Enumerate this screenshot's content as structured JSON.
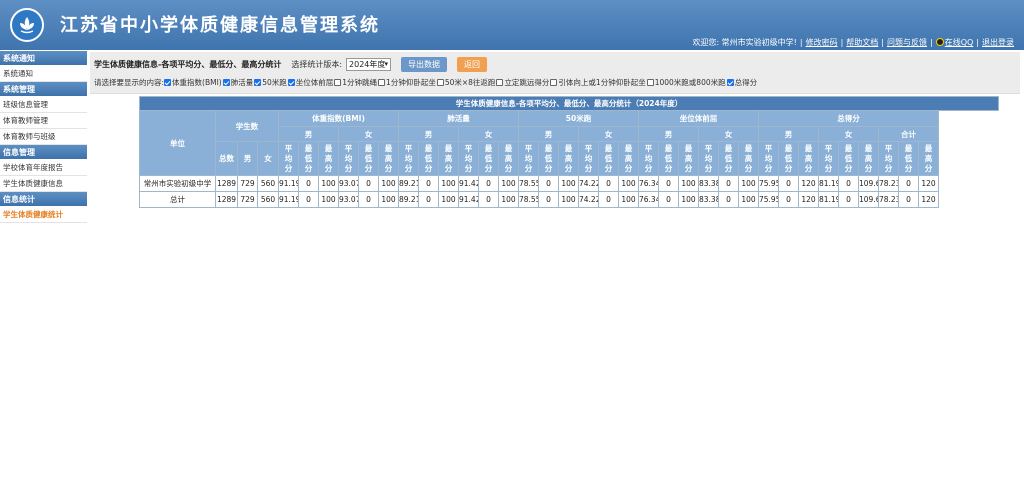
{
  "header": {
    "title": "江苏省中小学体质健康信息管理系统",
    "welcome": "欢迎您: 常州市实验初级中学!",
    "links": [
      "修改密码",
      "帮助文档",
      "问题与反馈",
      "在线QQ",
      "退出登录"
    ]
  },
  "sidebar": {
    "sections": [
      {
        "title": "系统通知",
        "items": [
          "系统通知"
        ]
      },
      {
        "title": "系统管理",
        "items": [
          "班级信息管理",
          "体育教师管理",
          "体育教师与班级"
        ]
      },
      {
        "title": "信息管理",
        "items": [
          "学校体育年度报告",
          "学生体质健康信息"
        ]
      },
      {
        "title": "信息统计",
        "items": [
          "学生体质健康统计"
        ]
      }
    ],
    "active_item": "学生体质健康统计"
  },
  "toolbar": {
    "title": "学生体质健康信息-各项平均分、最低分、最高分统计",
    "version_label": "选择统计版本:",
    "version_value": "2024年度",
    "export_label": "导出数据",
    "back_label": "返回",
    "options_label": "请选择要显示的内容:",
    "options": [
      {
        "label": "体重指数(BMI)",
        "checked": true
      },
      {
        "label": "肺活量",
        "checked": true
      },
      {
        "label": "50米跑",
        "checked": true
      },
      {
        "label": "坐位体前屈",
        "checked": true
      },
      {
        "label": "1分钟跳绳",
        "checked": false
      },
      {
        "label": "1分钟仰卧起坐",
        "checked": false
      },
      {
        "label": "50米×8往返跑",
        "checked": false
      },
      {
        "label": "立定跳远得分",
        "checked": false
      },
      {
        "label": "引体向上或1分钟仰卧起坐",
        "checked": false
      },
      {
        "label": "1000米跑或800米跑",
        "checked": false
      },
      {
        "label": "总得分",
        "checked": true
      }
    ]
  },
  "table": {
    "caption": "学生体质健康信息-各项平均分、最低分、最高分统计（2024年度）",
    "unit_header": "单位",
    "count_header": "学生数",
    "count_sub": [
      "总数",
      "男",
      "女"
    ],
    "groups": [
      "体重指数(BMI)",
      "肺活量",
      "50米跑",
      "坐位体前屈",
      "总得分"
    ],
    "sub_headers": [
      "男",
      "女"
    ],
    "total_sub_header": "合计",
    "stat_headers": [
      "平均分",
      "最低分",
      "最高分"
    ],
    "rows": [
      {
        "unit": "常州市实验初级中学",
        "values": [
          "1289",
          "729",
          "560",
          "91.19",
          "0",
          "100",
          "93.07",
          "0",
          "100",
          "89.21",
          "0",
          "100",
          "91.42",
          "0",
          "100",
          "78.55",
          "0",
          "100",
          "74.22",
          "0",
          "100",
          "76.34",
          "0",
          "100",
          "83.38",
          "0",
          "100",
          "75.95",
          "0",
          "120",
          "81.19",
          "0",
          "109.6",
          "78.23",
          "0",
          "120"
        ]
      },
      {
        "unit": "总计",
        "values": [
          "1289",
          "729",
          "560",
          "91.19",
          "0",
          "100",
          "93.07",
          "0",
          "100",
          "89.21",
          "0",
          "100",
          "91.42",
          "0",
          "100",
          "78.55",
          "0",
          "100",
          "74.22",
          "0",
          "100",
          "76.34",
          "0",
          "100",
          "83.38",
          "0",
          "100",
          "75.95",
          "0",
          "120",
          "81.19",
          "0",
          "109.6",
          "78.23",
          "0",
          "120"
        ]
      }
    ]
  },
  "colors": {
    "header_bg": "#4a7fb8",
    "table_header_bg": "#8ab0d7",
    "caption_bg": "#4b7cb3",
    "active_link": "#e67e22",
    "export_button": "#6b98c9",
    "back_button": "#f0a050"
  }
}
